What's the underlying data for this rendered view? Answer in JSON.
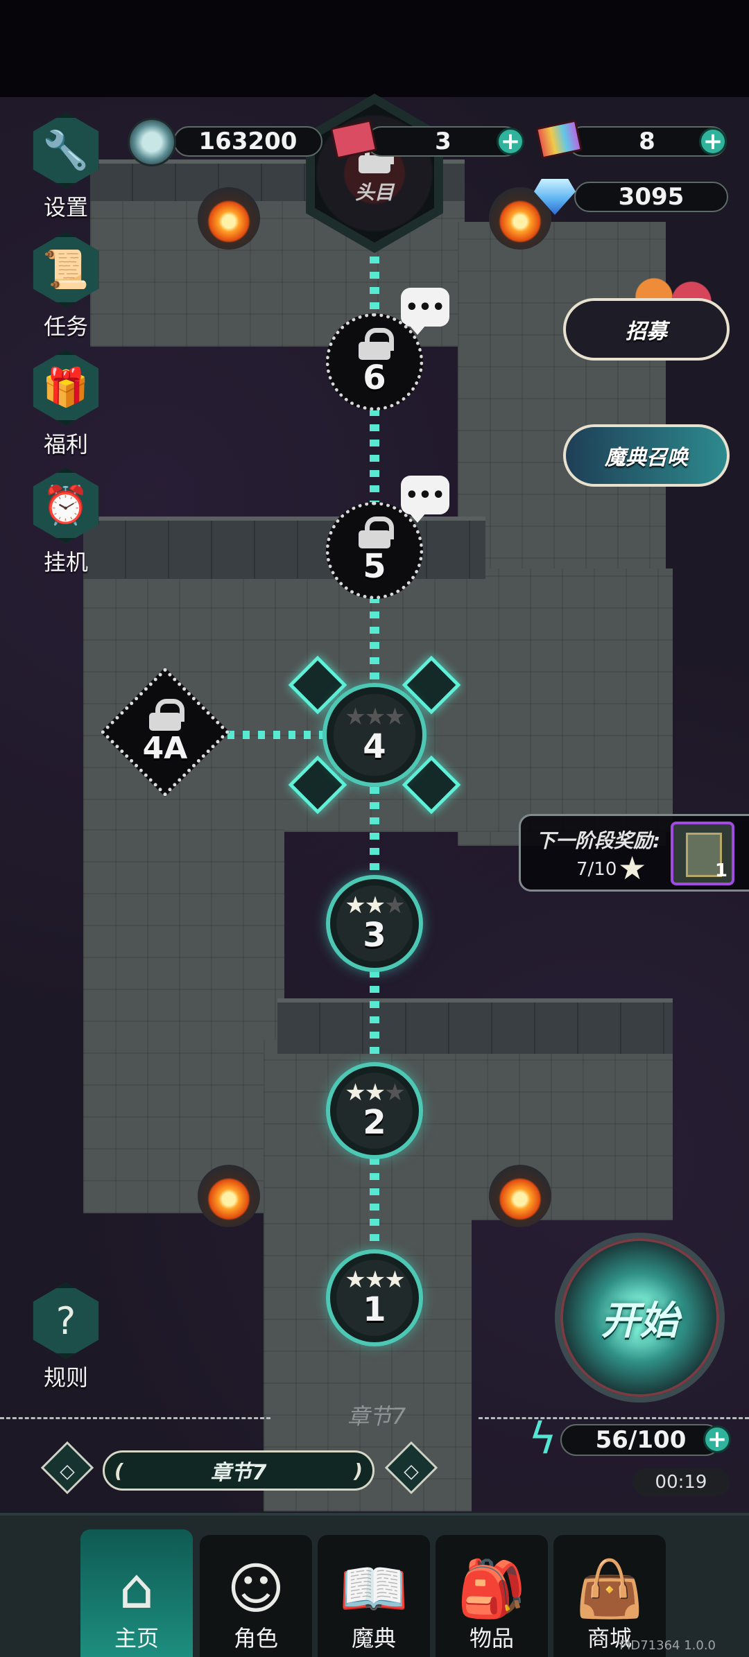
{
  "resources": {
    "coins": "163200",
    "tickets": "3",
    "rainbow_tickets": "8",
    "gems": "3095"
  },
  "side_menu": [
    {
      "label": "设置",
      "icon": "wrench-icon"
    },
    {
      "label": "任务",
      "icon": "scroll-icon"
    },
    {
      "label": "福利",
      "icon": "gift-icon"
    },
    {
      "label": "挂机",
      "icon": "sleep-clock-icon"
    }
  ],
  "rules_label": "规则",
  "boss": {
    "label": "头目"
  },
  "right_buttons": {
    "recruit": "招募",
    "grimoire_summon": "魔典召唤"
  },
  "stages": [
    {
      "num": "6",
      "locked": true
    },
    {
      "num": "5",
      "locked": true
    },
    {
      "num": "4",
      "stars": 0,
      "current": true
    },
    {
      "num": "3",
      "stars": 2
    },
    {
      "num": "2",
      "stars": 2
    },
    {
      "num": "1",
      "stars": 3
    }
  ],
  "side_stage": {
    "num": "4A",
    "locked": true
  },
  "next_reward": {
    "title": "下一阶段奖励:",
    "progress": "7/10",
    "item_count": "1"
  },
  "start_label": "开始",
  "chapter": {
    "ghost_label": "章节7",
    "current": "章节7"
  },
  "energy": {
    "value": "56/100",
    "timer": "00:19"
  },
  "nav": [
    {
      "label": "主页",
      "icon": "home-icon",
      "active": true
    },
    {
      "label": "角色",
      "icon": "character-icon"
    },
    {
      "label": "魔典",
      "icon": "book-icon"
    },
    {
      "label": "物品",
      "icon": "backpack-icon"
    },
    {
      "label": "商城",
      "icon": "shop-bag-icon"
    }
  ],
  "build": "PID71364 1.0.0",
  "colors": {
    "path": "#58e9d3",
    "accent": "#2fb39c",
    "star_on": "#f2efe4",
    "star_off": "#555555"
  }
}
